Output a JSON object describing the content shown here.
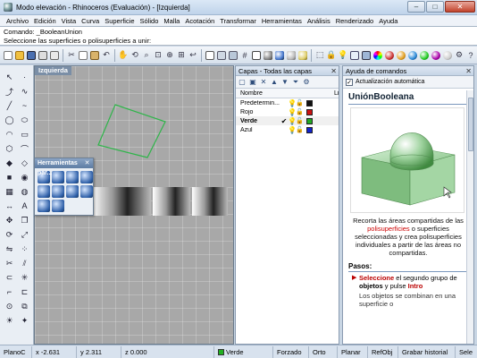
{
  "window": {
    "title": "Modo elevación - Rhinoceros (Evaluación) - [Izquierda]",
    "buttons": [
      "–",
      "□",
      "✕"
    ]
  },
  "menu": [
    "Archivo",
    "Edición",
    "Vista",
    "Curva",
    "Superficie",
    "Sólido",
    "Malla",
    "Acotación",
    "Transformar",
    "Herramientas",
    "Análisis",
    "Renderizado",
    "Ayuda"
  ],
  "command": {
    "history": "Comando: _BooleanUnion",
    "prompt": "Seleccione las superficies o polisuperficies a unir:"
  },
  "viewport": {
    "label": "Izquierda"
  },
  "floating_toolbar": {
    "title": "Herramientas par...",
    "close": "✕"
  },
  "layers_panel": {
    "title": "Capas - Todas las capas",
    "close": "✕",
    "columns": {
      "name": "Nombre",
      "material": "Librer"
    },
    "layers": [
      {
        "name": "Predetermin...",
        "current": false,
        "color": "#111111"
      },
      {
        "name": "Rojo",
        "current": false,
        "color": "#cc1111"
      },
      {
        "name": "Verde",
        "current": true,
        "check": "✔",
        "color": "#22aa22"
      },
      {
        "name": "Azul",
        "current": false,
        "color": "#1122cc"
      }
    ]
  },
  "help_panel": {
    "title": "Ayuda de comandos",
    "close": "✕",
    "auto_update": "Actualización automática",
    "heading": "UniónBooleana",
    "desc_part1": "Recorta las áreas compartidas de las ",
    "desc_link": "polisuperficies",
    "desc_part2": " o superficies seleccionadas y crea polisuperficies individuales a partir de las áreas no compartidas.",
    "steps_heading": "Pasos:",
    "step1_a": "Seleccione",
    "step1_b": " el segundo grupo de ",
    "step1_c": "objetos",
    "step1_d": " y pulse ",
    "step1_e": "Intro",
    "note": "Los objetos se combinan en una superficie o"
  },
  "status": {
    "cplane": "PlanoC",
    "x": "x -2.631",
    "y": "y 2.311",
    "z": "z 0.000",
    "layer": "Verde",
    "toggles": [
      "Forzado",
      "Orto",
      "Planar",
      "RefObj",
      "Grabar historial",
      "Sele"
    ]
  }
}
